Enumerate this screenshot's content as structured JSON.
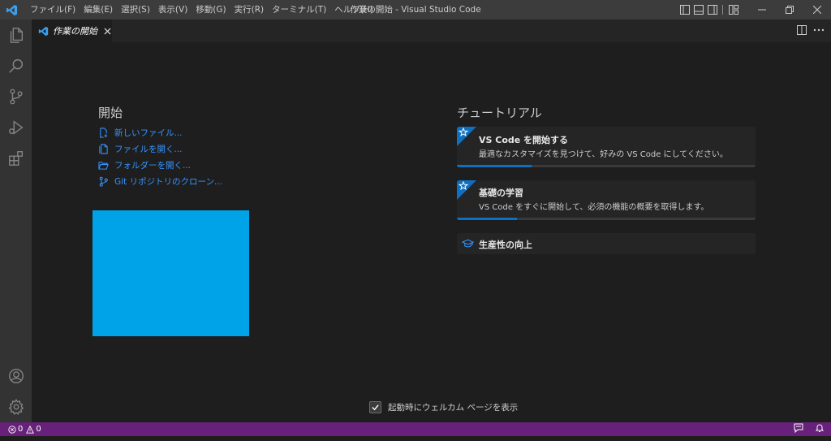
{
  "titlebar": {
    "menu": [
      "ファイル(F)",
      "編集(E)",
      "選択(S)",
      "表示(V)",
      "移動(G)",
      "実行(R)",
      "ターミナル(T)",
      "ヘルプ(H)"
    ],
    "window_title": "作業の開始 - Visual Studio Code"
  },
  "activitybar": {
    "icons": [
      "explorer-icon",
      "search-icon",
      "source-control-icon",
      "run-debug-icon",
      "extensions-icon",
      "account-icon",
      "settings-gear-icon"
    ]
  },
  "tab": {
    "label": "作業の開始"
  },
  "start": {
    "title": "開始",
    "items": [
      "新しいファイル...",
      "ファイルを開く...",
      "フォルダーを開く...",
      "Git リポジトリのクローン..."
    ]
  },
  "tutorials": {
    "title": "チュートリアル",
    "cards": [
      {
        "title": "VS Code を開始する",
        "description": "最適なカスタマイズを見つけて、好みの VS Code にしてください。",
        "progress": 0.25
      },
      {
        "title": "基礎の学習",
        "description": "VS Code をすぐに開始して、必須の機能の概要を取得します。",
        "progress": 0.2
      },
      {
        "title": "生産性の向上"
      }
    ]
  },
  "footer": {
    "show_on_startup_label": "起動時にウェルカム ページを表示",
    "checked": true
  },
  "statusbar": {
    "errors": "0",
    "warnings": "0"
  },
  "colors": {
    "accent": "#0e70c0",
    "statusbar": "#68217a",
    "link": "#3794ff",
    "image_placeholder": "#00a2e8"
  }
}
